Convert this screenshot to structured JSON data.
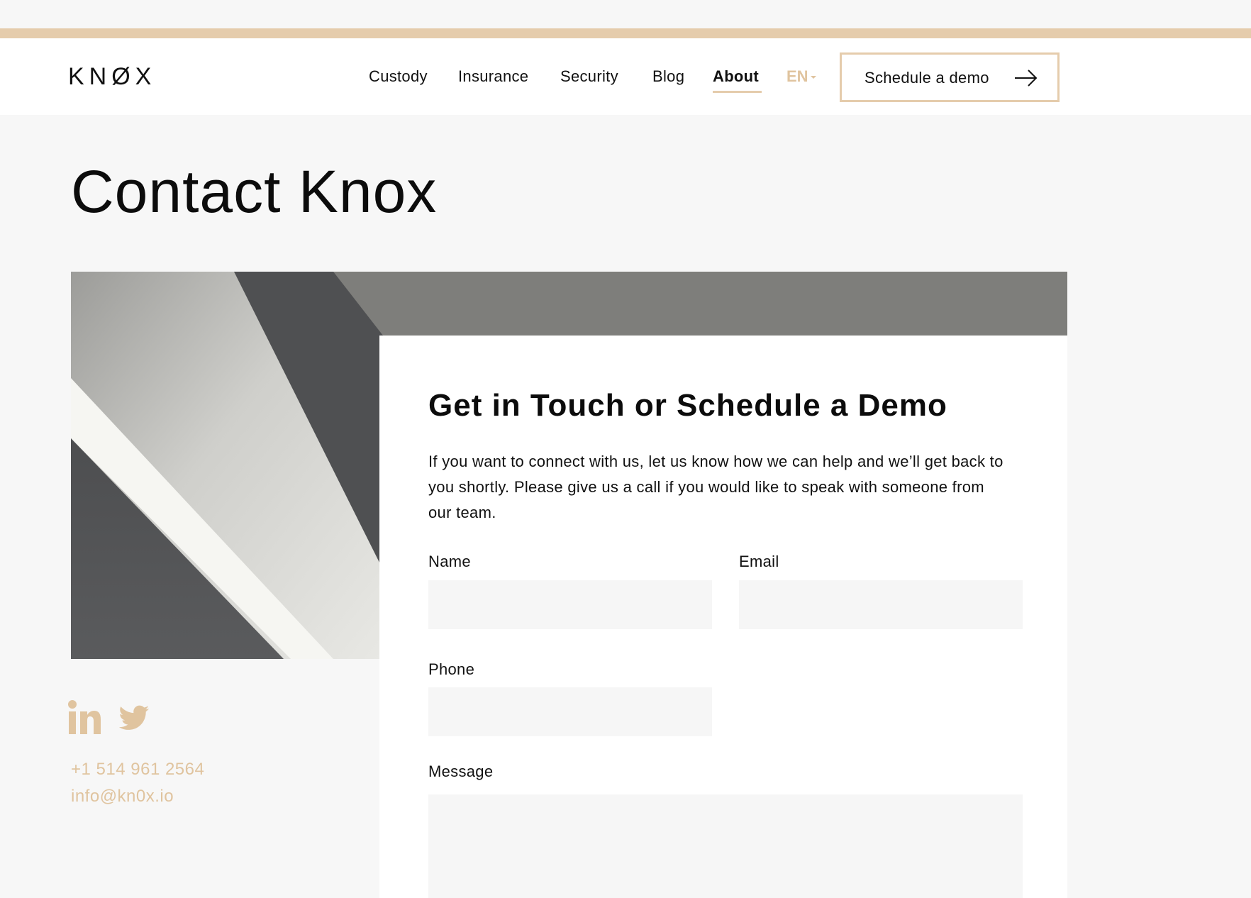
{
  "header": {
    "logo_text": "KNØX",
    "nav": [
      {
        "label": "Custody"
      },
      {
        "label": "Insurance"
      },
      {
        "label": "Security"
      },
      {
        "label": "Blog"
      },
      {
        "label": "About",
        "active": true
      }
    ],
    "language": "EN",
    "cta_label": "Schedule a demo"
  },
  "page": {
    "title": "Contact Knox"
  },
  "form_card": {
    "title": "Get in Touch or Schedule a Demo",
    "intro": "If you want to connect with us, let us know how we can help and we’ll get back to you shortly. Please give us a call if you would like to speak with someone from our team.",
    "fields": {
      "name": {
        "label": "Name",
        "value": ""
      },
      "email": {
        "label": "Email",
        "value": ""
      },
      "phone": {
        "label": "Phone",
        "value": ""
      },
      "message": {
        "label": "Message",
        "value": ""
      }
    }
  },
  "sidebar": {
    "social": [
      {
        "icon": "linkedin-icon"
      },
      {
        "icon": "twitter-icon"
      }
    ],
    "phone": "+1 514 961 2564",
    "email": "info@kn0x.io"
  },
  "colors": {
    "accent": "#e5ccac",
    "accent_text": "#e0c49f",
    "background": "#f7f7f7",
    "card": "#ffffff",
    "input": "#f6f6f6"
  }
}
